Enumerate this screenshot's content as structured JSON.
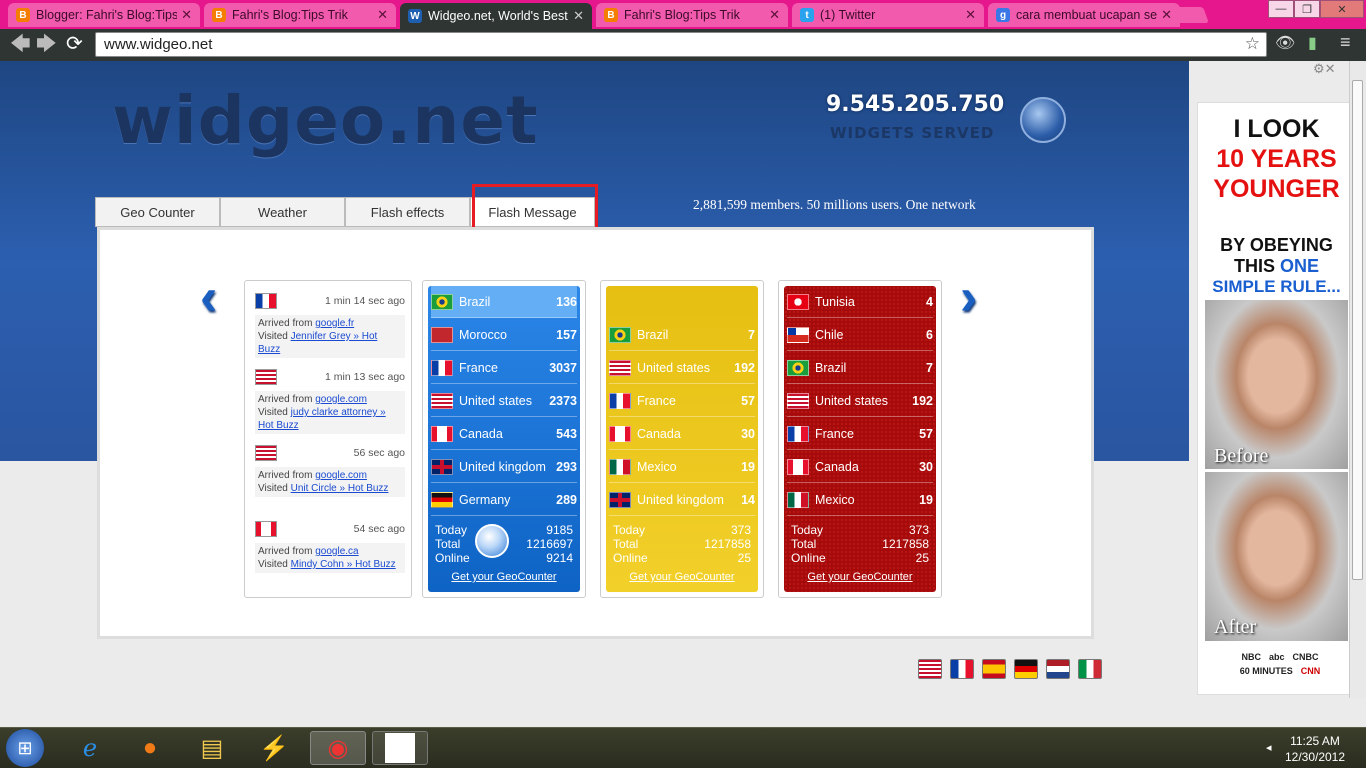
{
  "browser": {
    "tabs": [
      {
        "title": "Blogger: Fahri's Blog:Tips Trik",
        "favicon": "blogger-icon"
      },
      {
        "title": "Fahri's Blog:Tips Trik",
        "favicon": "blogger-icon"
      },
      {
        "title": "Widgeo.net, World's Best",
        "favicon": "widgeo-icon",
        "active": true
      },
      {
        "title": "Fahri's Blog:Tips Trik",
        "favicon": "blogger-icon"
      },
      {
        "title": "(1) Twitter",
        "favicon": "twitter-icon"
      },
      {
        "title": "cara membuat ucapan sel",
        "favicon": "google-icon"
      }
    ],
    "url": "www.widgeo.net"
  },
  "site": {
    "logo": "widgeo.net",
    "widgets_count": "9.545.205.750",
    "widgets_label": "WIDGETS SERVED",
    "members_text": "2,881,599 members. 50 millions users. One network",
    "tabs": [
      "Geo Counter",
      "Weather",
      "Flash effects",
      "Flash Message"
    ]
  },
  "feed": [
    {
      "time": "1 min 14 sec ago",
      "arrived_label": "Arrived from",
      "source": "google.fr",
      "visited_label": "Visited",
      "page": "Jennifer Grey » Hot Buzz",
      "flag": "france"
    },
    {
      "time": "1 min 13 sec ago",
      "arrived_label": "Arrived from",
      "source": "google.com",
      "visited_label": "Visited",
      "page": "judy clarke attorney » Hot Buzz",
      "flag": "usa"
    },
    {
      "time": "56 sec ago",
      "arrived_label": "Arrived from",
      "source": "google.com",
      "visited_label": "Visited",
      "page": "Unit Circle » Hot Buzz",
      "flag": "usa"
    },
    {
      "time": "54 sec ago",
      "arrived_label": "Arrived from",
      "source": "google.ca",
      "visited_label": "Visited",
      "page": "Mindy Cohn » Hot Buzz",
      "flag": "canada"
    }
  ],
  "counters": [
    {
      "theme": "blue",
      "rows": [
        {
          "country": "Brazil",
          "value": "136",
          "flag": "brazil"
        },
        {
          "country": "Morocco",
          "value": "157",
          "flag": "morocco"
        },
        {
          "country": "France",
          "value": "3037",
          "flag": "france"
        },
        {
          "country": "United states",
          "value": "2373",
          "flag": "usa"
        },
        {
          "country": "Canada",
          "value": "543",
          "flag": "canada"
        },
        {
          "country": "United kingdom",
          "value": "293",
          "flag": "uk"
        },
        {
          "country": "Germany",
          "value": "289",
          "flag": "germany"
        }
      ],
      "today_label": "Today",
      "today": "9185",
      "total_label": "Total",
      "total": "1216697",
      "online_label": "Online",
      "online": "9214",
      "link": "Get your GeoCounter"
    },
    {
      "theme": "yellow",
      "rows": [
        {
          "country": "Brazil",
          "value": "7",
          "flag": "brazil"
        },
        {
          "country": "United states",
          "value": "192",
          "flag": "usa"
        },
        {
          "country": "France",
          "value": "57",
          "flag": "france"
        },
        {
          "country": "Canada",
          "value": "30",
          "flag": "canada"
        },
        {
          "country": "Mexico",
          "value": "19",
          "flag": "mexico"
        },
        {
          "country": "United kingdom",
          "value": "14",
          "flag": "uk"
        }
      ],
      "today_label": "Today",
      "today": "373",
      "total_label": "Total",
      "total": "1217858",
      "online_label": "Online",
      "online": "25",
      "link": "Get your GeoCounter"
    },
    {
      "theme": "red",
      "rows": [
        {
          "country": "Tunisia",
          "value": "4",
          "flag": "tunisia"
        },
        {
          "country": "Chile",
          "value": "6",
          "flag": "chile"
        },
        {
          "country": "Brazil",
          "value": "7",
          "flag": "brazil"
        },
        {
          "country": "United states",
          "value": "192",
          "flag": "usa"
        },
        {
          "country": "France",
          "value": "57",
          "flag": "france"
        },
        {
          "country": "Canada",
          "value": "30",
          "flag": "canada"
        },
        {
          "country": "Mexico",
          "value": "19",
          "flag": "mexico"
        }
      ],
      "today_label": "Today",
      "today": "373",
      "total_label": "Total",
      "total": "1217858",
      "online_label": "Online",
      "online": "25",
      "link": "Get your GeoCounter"
    }
  ],
  "language_flags": [
    "usa",
    "france",
    "spain",
    "germany",
    "netherlands",
    "italy"
  ],
  "ad": {
    "line1": "I LOOK",
    "line2": "10 YEARS",
    "line3": "YOUNGER",
    "line4": "BY OBEYING",
    "line5a": "THIS",
    "line5b": "ONE",
    "line6": "SIMPLE RULE...",
    "before": "Before",
    "after": "After",
    "logos": [
      "NBC",
      "abc",
      "CNBC",
      "60 MINUTES",
      "CNN"
    ]
  },
  "taskbar": {
    "time": "11:25 AM",
    "date": "12/30/2012"
  },
  "colors": {
    "blue_counter": "#1f78d8",
    "yellow_counter": "#e9c214",
    "red_counter": "#b50d0d",
    "highlight": "#e51c23"
  }
}
